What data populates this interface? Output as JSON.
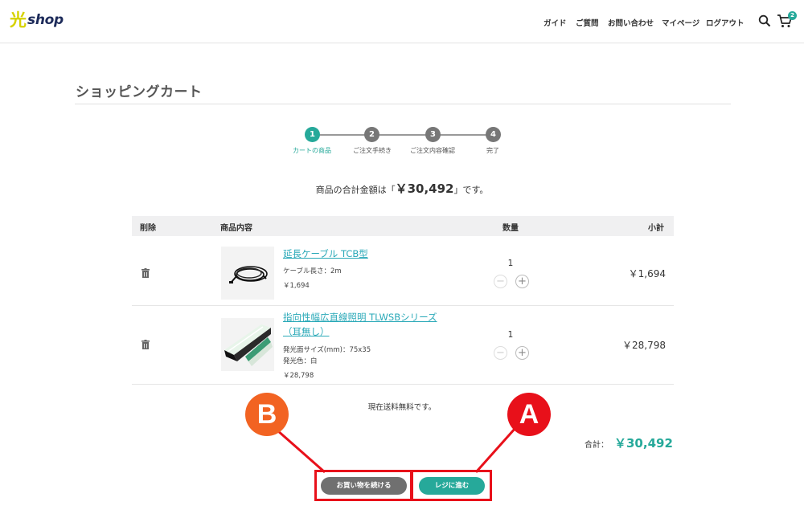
{
  "header": {
    "logo_kanji": "光",
    "logo_text": "shop",
    "nav": [
      "ガイド",
      "ご質問",
      "お問い合わせ",
      "マイページ",
      "ログアウト"
    ],
    "cart_count": "2"
  },
  "page": {
    "title": "ショッピングカート",
    "total_prefix": "商品の合計金額は「",
    "total_amount": "￥30,492",
    "total_suffix": "」です。"
  },
  "steps": [
    {
      "num": "1",
      "label": "カートの商品",
      "active": true
    },
    {
      "num": "2",
      "label": "ご注文手続き",
      "active": false
    },
    {
      "num": "3",
      "label": "ご注文内容確認",
      "active": false
    },
    {
      "num": "4",
      "label": "完了",
      "active": false
    }
  ],
  "table": {
    "headers": {
      "delete": "削除",
      "product": "商品内容",
      "qty": "数量",
      "subtotal": "小計"
    },
    "rows": [
      {
        "name": "延長ケーブル TCB型",
        "meta": [
          "ケーブル長さ：2m",
          "￥1,694"
        ],
        "qty": "1",
        "subtotal": "￥1,694"
      },
      {
        "name_line1": "指向性幅広直線照明 TLWSBシリーズ",
        "name_line2": "（耳無し）",
        "meta": [
          "発光面サイズ(mm)：75x35",
          "発光色：白",
          "￥28,798"
        ],
        "qty": "1",
        "subtotal": "￥28,798"
      }
    ]
  },
  "shipping_msg": "現在送料無料です。",
  "grand_total": {
    "label": "合計：",
    "value": "￥30,492"
  },
  "buttons": {
    "continue": "お買い物を続ける",
    "checkout": "レジに進む"
  },
  "annotations": {
    "a": "A",
    "b": "B"
  },
  "colors": {
    "accent": "#26a99a",
    "annotation_red": "#e8101a",
    "annotation_orange": "#f26322",
    "link": "#2aa9b8"
  }
}
